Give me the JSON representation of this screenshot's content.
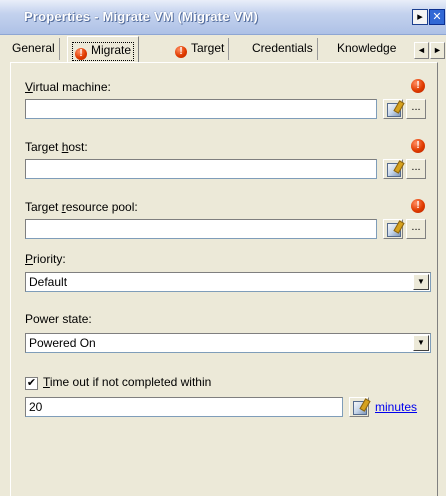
{
  "window": {
    "title": "Properties - Migrate VM (Migrate VM)",
    "dock_glyph": "▸",
    "close_glyph": "✕"
  },
  "tabs": [
    {
      "label": "General",
      "active": false,
      "error": false
    },
    {
      "label": "Migrate",
      "active": true,
      "error": true
    },
    {
      "label": "Target",
      "active": false,
      "error": true
    },
    {
      "label": "Credentials",
      "active": false,
      "error": false
    },
    {
      "label": "Knowledge",
      "active": false,
      "error": false
    }
  ],
  "tab_scroll": {
    "left": "◄",
    "right": "►"
  },
  "fields": {
    "virtual_machine": {
      "label_key": "V",
      "label_rest": "irtual machine:",
      "value": ""
    },
    "target_host": {
      "label_pre": "Target ",
      "label_key": "h",
      "label_rest": "ost:",
      "value": ""
    },
    "target_resource_pool": {
      "label_pre": "Target ",
      "label_key": "r",
      "label_rest": "esource pool:",
      "value": ""
    },
    "priority": {
      "label_key": "P",
      "label_rest": "riority:",
      "value": "Default"
    },
    "power_state": {
      "label": "Power state:",
      "value": "Powered On"
    },
    "timeout": {
      "checked": true,
      "check_glyph": "✔",
      "label_key": "T",
      "label_rest": "ime out if not completed within",
      "value": "20",
      "unit_link": "minutes"
    }
  },
  "glyphs": {
    "error": "!",
    "dots": "...",
    "dropdown": "▼"
  },
  "colors": {
    "error": "#e03b00",
    "link": "#0000ee",
    "title_bar": "#aec1e6"
  }
}
